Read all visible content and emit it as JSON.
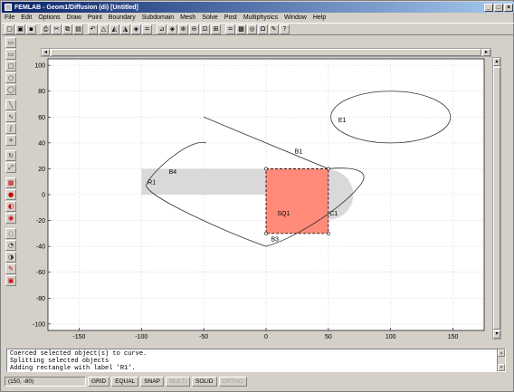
{
  "window": {
    "title": "FEMLAB - Geom1/Diffusion (di) [Untitled]",
    "controls": [
      "_",
      "□",
      "×"
    ]
  },
  "menu": [
    "File",
    "Edit",
    "Options",
    "Draw",
    "Point",
    "Boundary",
    "Subdomain",
    "Mesh",
    "Solve",
    "Post",
    "Multiphysics",
    "Window",
    "Help"
  ],
  "toolbar": {
    "icons": [
      "new-icon",
      "open-icon",
      "save-icon",
      "print-icon",
      "cut-icon",
      "copy-icon",
      "paste-icon",
      "undo-icon",
      "draw-mode-icon",
      "point-mode-icon",
      "boundary-mode-icon",
      "subdomain-mode-icon",
      "equal-icon",
      "mesh-icon",
      "refine-mesh-icon",
      "zoom-in-icon",
      "zoom-out-icon",
      "zoom-window-icon",
      "zoom-extents-icon",
      "solve-icon",
      "plot-icon",
      "animate-icon",
      "omega-icon",
      "plot-params-icon",
      "help-icon"
    ],
    "glyphs": [
      "▢",
      "▣",
      "▪",
      "⎙",
      "✂",
      "⧉",
      "▤",
      "↶",
      "△",
      "◭",
      "◮",
      "◈",
      "=",
      "⊿",
      "◈",
      "⊕",
      "⊖",
      "⊡",
      "⊞",
      "=",
      "▩",
      "◎",
      "Ω",
      "✎",
      "?"
    ]
  },
  "left_toolbar": {
    "icons": [
      "rectangle-icon",
      "rectangle-centered-icon",
      "square-icon",
      "ellipse-icon",
      "circle-icon",
      "line-icon",
      "curve-icon",
      "bezier-icon",
      "point-icon",
      "rotate-icon",
      "scale-icon",
      "union-icon",
      "intersection-icon",
      "difference-icon",
      "compose-icon",
      "coerce-solid-icon",
      "coerce-curve-icon",
      "split-icon",
      "delete-icon",
      "array-icon"
    ],
    "glyphs": [
      "▭",
      "▭",
      "□",
      "○",
      "◯",
      "╲",
      "∿",
      "∫",
      "+",
      "↻",
      "⤢",
      "▦",
      "●",
      "◐",
      "◉",
      "◌",
      "◔",
      "◑",
      "✎",
      "▣"
    ]
  },
  "plot": {
    "x_ticks": [
      -150,
      -100,
      -50,
      0,
      50,
      100,
      150
    ],
    "y_ticks": [
      100,
      80,
      60,
      40,
      20,
      0,
      -20,
      -40,
      -60,
      -80,
      -100
    ],
    "xlim": [
      -175,
      175
    ],
    "ylim": [
      -105,
      105
    ],
    "grid": true,
    "objects": {
      "R1": {
        "x": -100,
        "y": 0,
        "width": 150,
        "height": 20,
        "color": "#d9d9d9",
        "label": "R1"
      },
      "SQ1": {
        "x": 0,
        "y": -30,
        "width": 50,
        "height": 50,
        "color": "#ff8a7a",
        "label": "SQ1"
      },
      "E1": {
        "cx": 100,
        "cy": 60,
        "rx": 48,
        "ry": 20,
        "label": "E1"
      },
      "C1": {
        "cx": 50,
        "cy": 0,
        "r": 20,
        "color": "#d9d9d9",
        "label": "C1"
      }
    },
    "labels": [
      "E1",
      "B1",
      "B4",
      "R1",
      "SQ1",
      "C1",
      "B3"
    ]
  },
  "console": {
    "lines": [
      "Coerced selected object(s) to curve.",
      "Splitting selected objects",
      "Adding rectangle with label 'R1'."
    ]
  },
  "status": {
    "coords": "(150, -80)",
    "buttons": [
      {
        "label": "GRID",
        "enabled": true
      },
      {
        "label": "EQUAL",
        "enabled": true
      },
      {
        "label": "SNAP",
        "enabled": true
      },
      {
        "label": "MULTI",
        "enabled": false
      },
      {
        "label": "SOLID",
        "enabled": true
      },
      {
        "label": "ORTHO",
        "enabled": false
      }
    ]
  }
}
